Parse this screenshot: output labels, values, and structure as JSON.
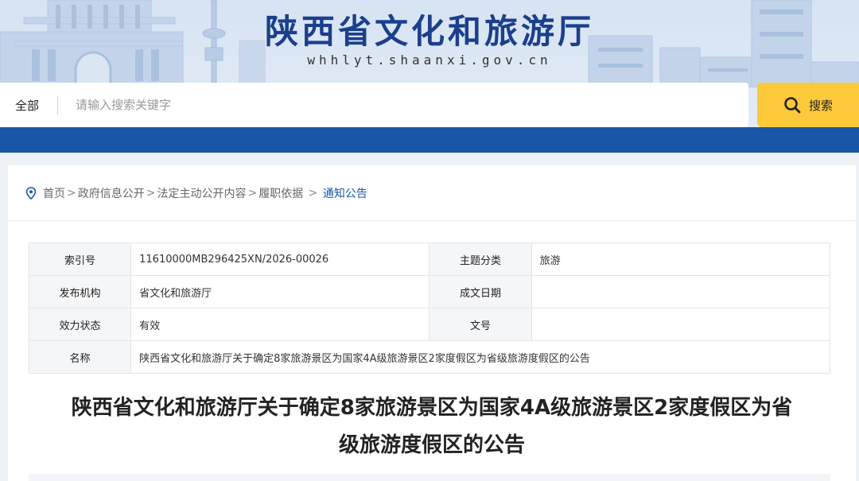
{
  "header": {
    "site_title": "陕西省文化和旅游厅",
    "site_domain": "whhlyt.shaanxi.gov.cn"
  },
  "search": {
    "scope_label": "全部",
    "placeholder": "请输入搜索关键字",
    "button_label": "搜索"
  },
  "breadcrumb": {
    "items": [
      "首页",
      "政府信息公开",
      "法定主动公开内容",
      "履职依据"
    ],
    "current": "通知公告"
  },
  "meta_table": {
    "rows": [
      {
        "k1": "索引号",
        "v1": "11610000MB296425XN/2026-00026",
        "k2": "主题分类",
        "v2": "旅游"
      },
      {
        "k1": "发布机构",
        "v1": "省文化和旅游厅",
        "k2": "成文日期",
        "v2": ""
      },
      {
        "k1": "效力状态",
        "v1": "有效",
        "k2": "文号",
        "v2": ""
      }
    ],
    "name_label": "名称",
    "name_value": "陕西省文化和旅游厅关于确定8家旅游景区为国家4A级旅游景区2家度假区为省级旅游度假区的公告"
  },
  "document": {
    "title_line1": "陕西省文化和旅游厅关于确定8家旅游景区为国家4A级旅游景区2家度假区为省",
    "title_line2": "级旅游度假区的公告"
  },
  "colors": {
    "brand_blue": "#1a56a8",
    "title_blue": "#1b3f8c",
    "search_yellow": "#fcc93a"
  }
}
